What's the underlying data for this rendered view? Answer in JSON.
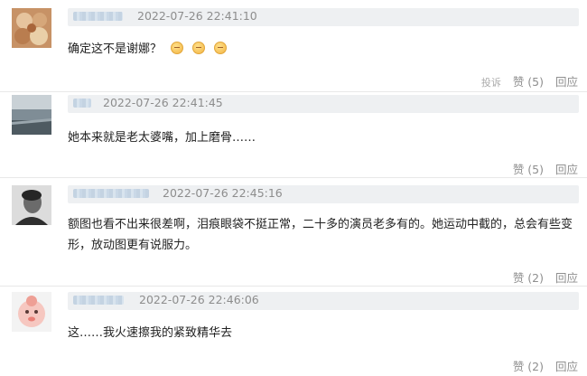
{
  "comments": [
    {
      "timestamp": "2022-07-26 22:41:10",
      "text": "确定这不是谢娜？",
      "emojis": [
        "confused-face-icon",
        "grimace-face-icon",
        "surprised-face-icon"
      ],
      "report_label": "投诉",
      "like_label": "赞 (5)",
      "reply_label": "回应"
    },
    {
      "timestamp": "2022-07-26 22:41:45",
      "text": "她本来就是老太婆嘴，加上磨骨……",
      "like_label": "赞 (5)",
      "reply_label": "回应"
    },
    {
      "timestamp": "2022-07-26 22:45:16",
      "text_line1": "额图也看不出来很差啊，泪痕眼袋不挺正常，二十多的演员老多有的。她运动中截的，总会有些变",
      "text_line2": "形，放动图更有说服力。",
      "like_label": "赞 (2)",
      "reply_label": "回应"
    },
    {
      "timestamp": "2022-07-26 22:46:06",
      "text": "这……我火速擦我的紧致精华去",
      "like_label": "赞 (2)",
      "reply_label": "回应"
    }
  ]
}
